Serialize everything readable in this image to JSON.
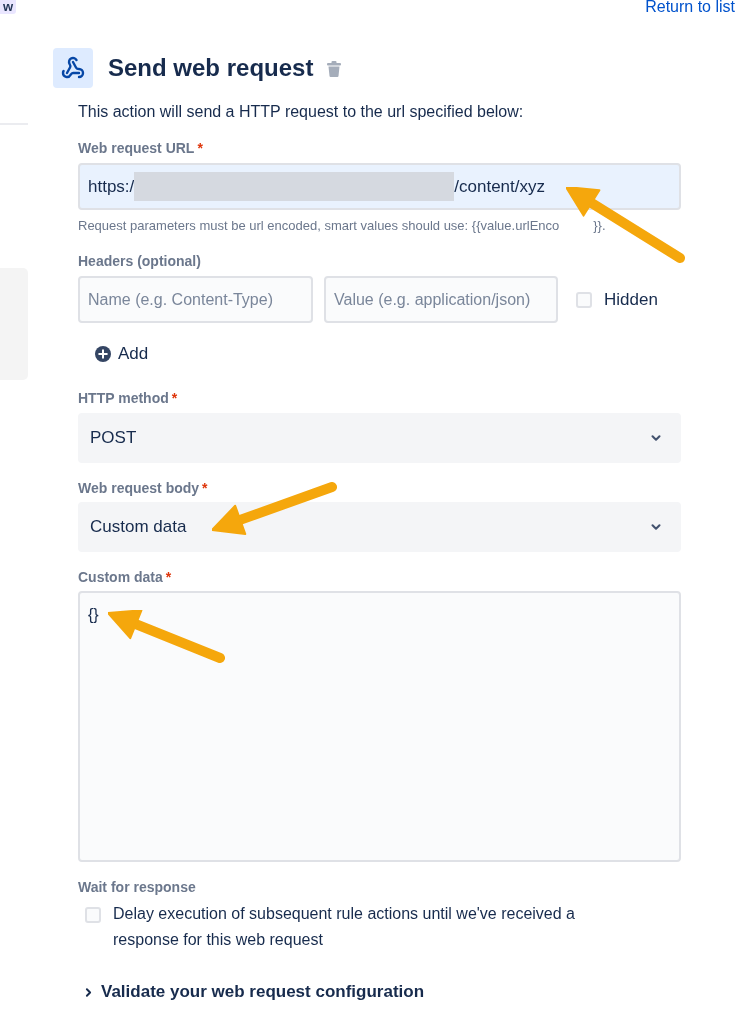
{
  "corner_badge": {
    "text": "w"
  },
  "return_link": {
    "label": "Return to list"
  },
  "action": {
    "title": "Send web request",
    "description": "This action will send a HTTP request to the url specified below:"
  },
  "url_field": {
    "label": "Web request URL",
    "required_mark": "*",
    "value_start": "https:/",
    "redacted": true,
    "value_end": "/content/xyz",
    "hint_parts": [
      "Request parameters must be url encoded, smart values should use: {{value.urlEnco",
      "}}."
    ]
  },
  "headers": {
    "label": "Headers (optional)",
    "name_placeholder": "Name (e.g. Content-Type)",
    "value_placeholder": "Value (e.g. application/json)",
    "hidden": {
      "label": "Hidden",
      "checked": false
    },
    "add_label": "Add"
  },
  "http_method": {
    "label": "HTTP method",
    "required_mark": "*",
    "value": "POST"
  },
  "body": {
    "label": "Web request body",
    "required_mark": "*",
    "value": "Custom data"
  },
  "custom_data": {
    "label": "Custom data",
    "required_mark": "*",
    "value": "{}"
  },
  "wait": {
    "label": "Wait for response",
    "option": {
      "label": "Delay execution of subsequent rule actions until we've received a response for this web request",
      "checked": false
    }
  },
  "validate": {
    "label": "Validate your web request configuration",
    "expanded": false
  }
}
